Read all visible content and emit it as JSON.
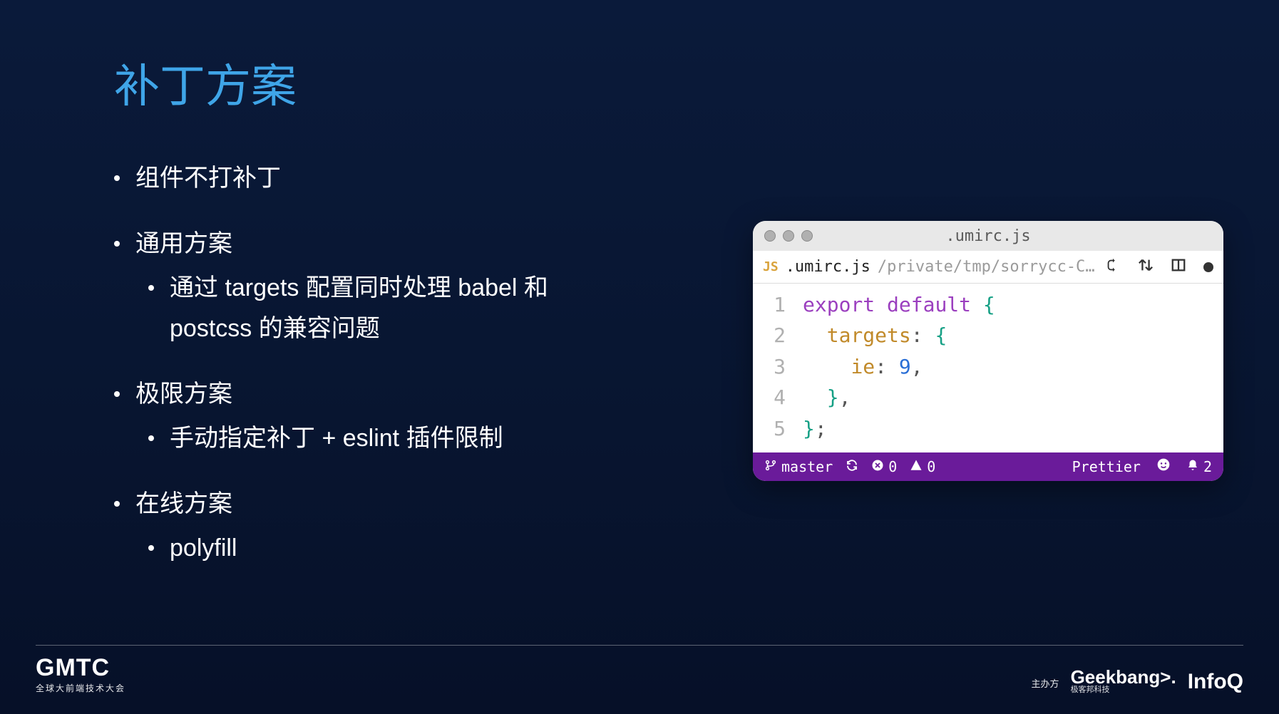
{
  "title": "补丁方案",
  "bullets": {
    "b1": "组件不打补丁",
    "b2": "通用方案",
    "b2_1": "通过 targets 配置同时处理 babel 和 postcss 的兼容问题",
    "b3": "极限方案",
    "b3_1": "手动指定补丁 + eslint 插件限制",
    "b4": "在线方案",
    "b4_1": "polyfill"
  },
  "editor": {
    "window_filename": ".umirc.js",
    "tab": {
      "lang_badge": "JS",
      "filename": ".umirc.js",
      "path": "/private/tmp/sorrycc-CB..."
    },
    "code": {
      "l1": {
        "n": "1",
        "kw1": "export",
        "kw2": "default",
        "brace": "{"
      },
      "l2": {
        "n": "2",
        "indent": "  ",
        "prop": "targets",
        "colon": ":",
        "brace": "{"
      },
      "l3": {
        "n": "3",
        "indent": "    ",
        "prop": "ie",
        "colon": ":",
        "num": "9",
        "comma": ","
      },
      "l4": {
        "n": "4",
        "indent": "  ",
        "brace": "}",
        "comma": ","
      },
      "l5": {
        "n": "5",
        "brace": "}",
        "semi": ";"
      }
    },
    "status": {
      "branch": "master",
      "errors": "0",
      "warnings": "0",
      "formatter": "Prettier",
      "notifications": "2"
    }
  },
  "footer": {
    "gmtc": "GMTC",
    "gmtc_sub": "全球大前端技术大会",
    "sponsor_label": "主办方",
    "geek": "Geekbang>.",
    "geek_sub": "极客邦科技",
    "infoq": "InfoQ"
  }
}
